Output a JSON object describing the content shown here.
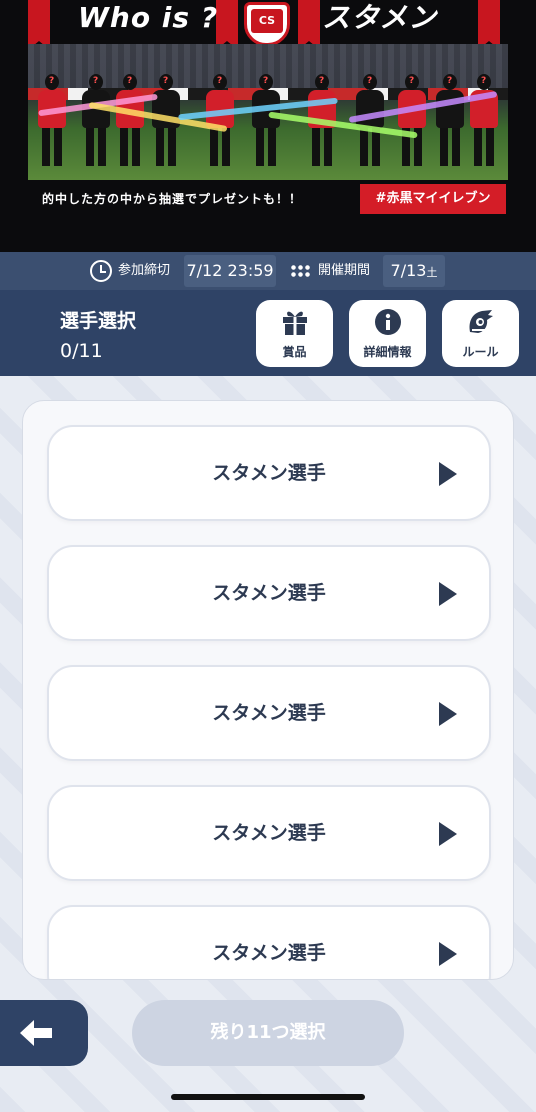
{
  "banner": {
    "title_left": "Who is ?",
    "title_right": "スタメン",
    "caption": "的中した方の中から抽選でプレゼントも！！",
    "hashtag": "#赤黒マイイレブン",
    "emblem_text": "CS"
  },
  "info": {
    "deadline_label": "参加締切",
    "deadline_value": "7/12 23:59",
    "period_label": "開催期間",
    "period_value": "7/13",
    "period_suffix": "土"
  },
  "header": {
    "title": "選手選択",
    "count": "0/11",
    "buttons": [
      {
        "label": "賞品",
        "icon": "gift-icon"
      },
      {
        "label": "詳細情報",
        "icon": "info-icon"
      },
      {
        "label": "ルール",
        "icon": "mascot-icon"
      }
    ]
  },
  "players": [
    {
      "label": "スタメン選手"
    },
    {
      "label": "スタメン選手"
    },
    {
      "label": "スタメン選手"
    },
    {
      "label": "スタメン選手"
    },
    {
      "label": "スタメン選手"
    }
  ],
  "footer": {
    "submit_label": "残り11つ選択"
  },
  "colors": {
    "navy": "#2f4366",
    "red": "#d41d27",
    "disabled": "#cdd4e2"
  }
}
